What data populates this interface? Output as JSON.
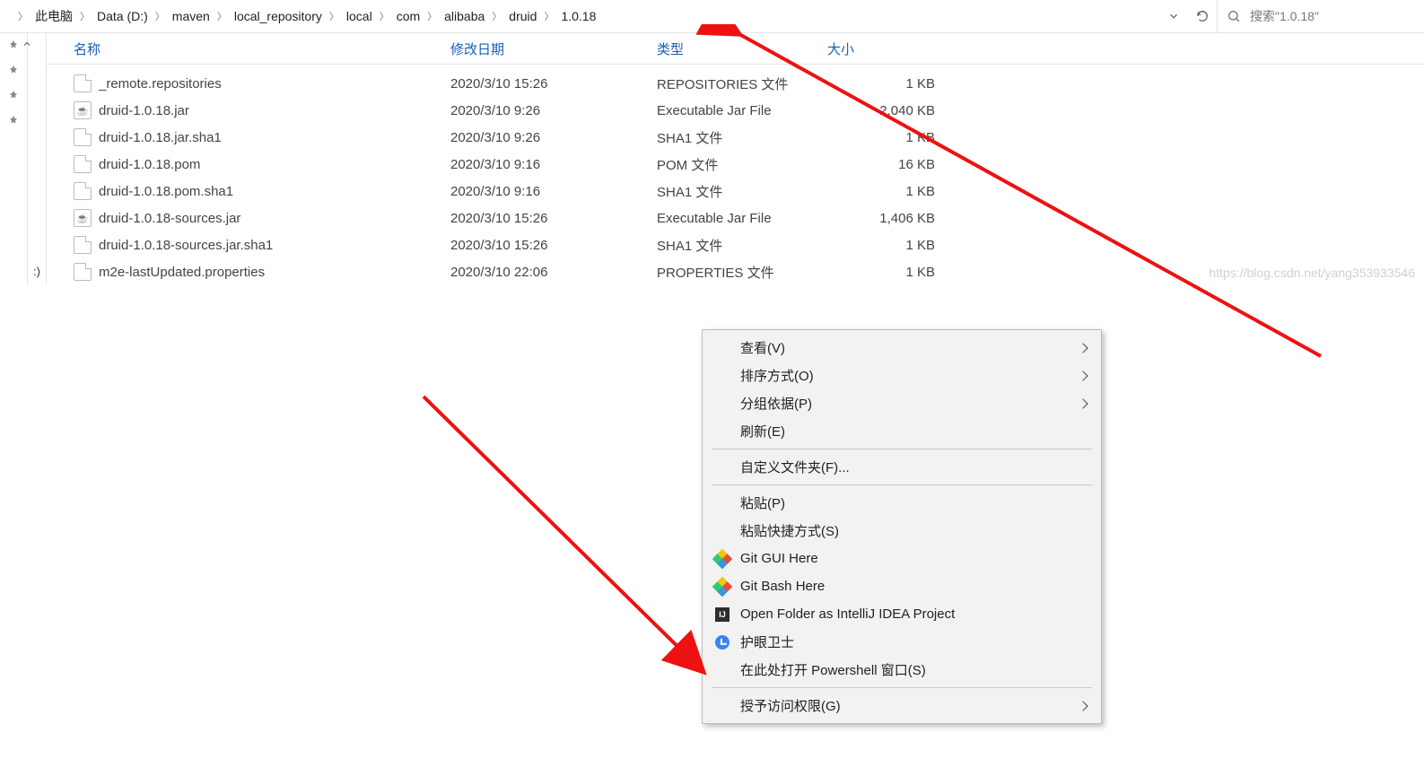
{
  "breadcrumb": {
    "items": [
      {
        "label": "此电脑"
      },
      {
        "label": "Data (D:)"
      },
      {
        "label": "maven"
      },
      {
        "label": "local_repository"
      },
      {
        "label": "local"
      },
      {
        "label": "com"
      },
      {
        "label": "alibaba"
      },
      {
        "label": "druid"
      },
      {
        "label": "1.0.18"
      }
    ]
  },
  "search": {
    "placeholder": "搜索\"1.0.18\""
  },
  "columns": {
    "name": "名称",
    "date": "修改日期",
    "type": "类型",
    "size": "大小"
  },
  "files": [
    {
      "icon": "file",
      "name": "_remote.repositories",
      "date": "2020/3/10 15:26",
      "type": "REPOSITORIES 文件",
      "size": "1 KB"
    },
    {
      "icon": "jar",
      "name": "druid-1.0.18.jar",
      "date": "2020/3/10 9:26",
      "type": "Executable Jar File",
      "size": "2,040 KB"
    },
    {
      "icon": "file",
      "name": "druid-1.0.18.jar.sha1",
      "date": "2020/3/10 9:26",
      "type": "SHA1 文件",
      "size": "1 KB"
    },
    {
      "icon": "file",
      "name": "druid-1.0.18.pom",
      "date": "2020/3/10 9:16",
      "type": "POM 文件",
      "size": "16 KB"
    },
    {
      "icon": "file",
      "name": "druid-1.0.18.pom.sha1",
      "date": "2020/3/10 9:16",
      "type": "SHA1 文件",
      "size": "1 KB"
    },
    {
      "icon": "jar",
      "name": "druid-1.0.18-sources.jar",
      "date": "2020/3/10 15:26",
      "type": "Executable Jar File",
      "size": "1,406 KB"
    },
    {
      "icon": "file",
      "name": "druid-1.0.18-sources.jar.sha1",
      "date": "2020/3/10 15:26",
      "type": "SHA1 文件",
      "size": "1 KB"
    },
    {
      "icon": "file",
      "name": "m2e-lastUpdated.properties",
      "date": "2020/3/10 22:06",
      "type": "PROPERTIES 文件",
      "size": "1 KB"
    }
  ],
  "context_menu": [
    {
      "label": "查看(V)",
      "arrow": true
    },
    {
      "label": "排序方式(O)",
      "arrow": true
    },
    {
      "label": "分组依据(P)",
      "arrow": true
    },
    {
      "label": "刷新(E)"
    },
    {
      "sep": true
    },
    {
      "label": "自定义文件夹(F)..."
    },
    {
      "sep": true
    },
    {
      "label": "粘贴(P)"
    },
    {
      "label": "粘贴快捷方式(S)"
    },
    {
      "label": "Git GUI Here",
      "icon": "git"
    },
    {
      "label": "Git Bash Here",
      "icon": "git"
    },
    {
      "label": "Open Folder as IntelliJ IDEA Project",
      "icon": "ij"
    },
    {
      "label": "护眼卫士",
      "icon": "clock"
    },
    {
      "label": "在此处打开 Powershell 窗口(S)"
    },
    {
      "sep": true
    },
    {
      "label": "授予访问权限(G)",
      "arrow": true
    }
  ],
  "nav_label": ":)",
  "watermark": "https://blog.csdn.net/yang353933546"
}
